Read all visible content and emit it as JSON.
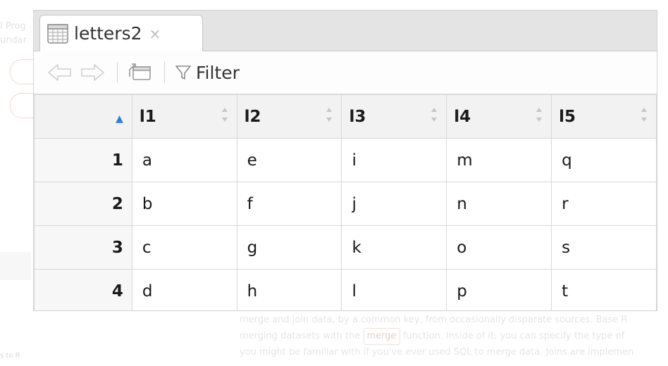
{
  "background": {
    "left_lines": [
      "l Prog",
      "undar"
    ],
    "paragraph_lines": [
      "merge and join data, by a common key, from occasionally disparate sources. Base R",
      "merging datasets with the",
      "function. Inside of it, you can specify the type of",
      "you might be familiar with if you've ever used SQL to merge data. Joins are implemen"
    ],
    "code_word": "merge",
    "bottom_left_label": "s to R"
  },
  "viewer": {
    "tab": {
      "label": "letters2",
      "close": "×",
      "icon": "table-icon"
    },
    "toolbar": {
      "back_icon": "arrow-left-icon",
      "forward_icon": "arrow-right-icon",
      "popout_icon": "popout-window-icon",
      "filter_icon": "funnel-icon",
      "filter_label": "Filter"
    },
    "columns": [
      "l1",
      "l2",
      "l3",
      "l4",
      "l5"
    ],
    "rows": [
      {
        "num": "1",
        "cells": [
          "a",
          "e",
          "i",
          "m",
          "q"
        ]
      },
      {
        "num": "2",
        "cells": [
          "b",
          "f",
          "j",
          "n",
          "r"
        ]
      },
      {
        "num": "3",
        "cells": [
          "c",
          "g",
          "k",
          "o",
          "s"
        ]
      },
      {
        "num": "4",
        "cells": [
          "d",
          "h",
          "l",
          "p",
          "t"
        ]
      }
    ]
  },
  "colors": {
    "sort_accent": "#2f7fd9",
    "tab_bar": "#e4e4e4",
    "grid_line": "#d8d8d8"
  }
}
